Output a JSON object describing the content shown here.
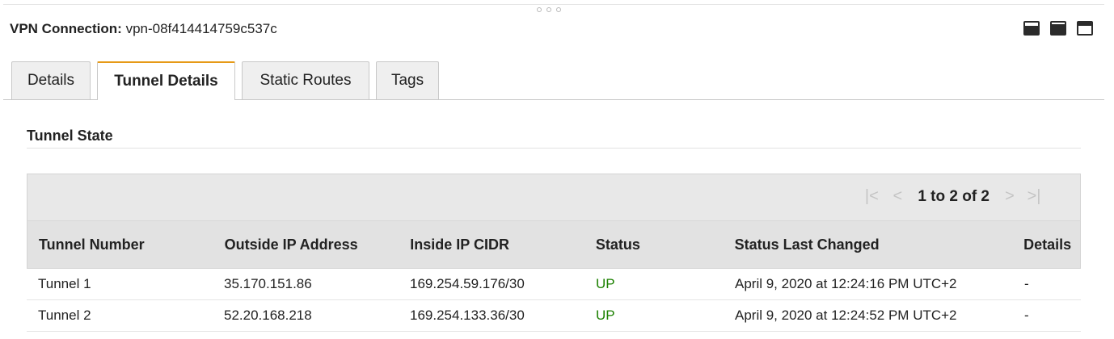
{
  "header": {
    "label": "VPN Connection:",
    "value": "vpn-08f414414759c537c"
  },
  "tabs": [
    {
      "label": "Details"
    },
    {
      "label": "Tunnel Details"
    },
    {
      "label": "Static Routes"
    },
    {
      "label": "Tags"
    }
  ],
  "active_tab": "Tunnel Details",
  "section": {
    "title": "Tunnel State"
  },
  "pager": {
    "text": "1 to 2 of 2"
  },
  "table": {
    "columns": [
      "Tunnel Number",
      "Outside IP Address",
      "Inside IP CIDR",
      "Status",
      "Status Last Changed",
      "Details"
    ],
    "rows": [
      [
        "Tunnel 1",
        "35.170.151.86",
        "169.254.59.176/30",
        "UP",
        "April 9, 2020 at 12:24:16 PM UTC+2",
        "-"
      ],
      [
        "Tunnel 2",
        "52.20.168.218",
        "169.254.133.36/30",
        "UP",
        "April 9, 2020 at 12:24:52 PM UTC+2",
        "-"
      ]
    ]
  },
  "colors": {
    "status_up": "#1d8102",
    "active_tab_accent": "#e69a17"
  },
  "icons": [
    "panel-bottom-icon",
    "panel-half-icon",
    "panel-top-icon",
    "first-page-icon",
    "prev-page-icon",
    "next-page-icon",
    "last-page-icon"
  ]
}
